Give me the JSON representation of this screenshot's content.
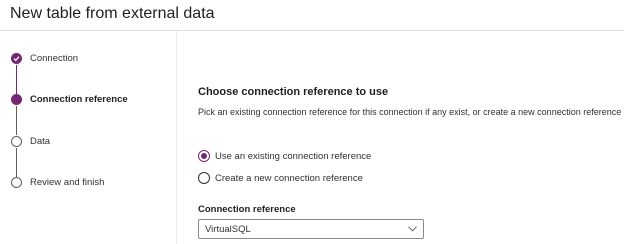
{
  "header": {
    "title": "New table from external data"
  },
  "stepper": {
    "steps": [
      {
        "label": "Connection",
        "state": "completed"
      },
      {
        "label": "Connection reference",
        "state": "current"
      },
      {
        "label": "Data",
        "state": "pending"
      },
      {
        "label": "Review and finish",
        "state": "pending"
      }
    ]
  },
  "main": {
    "title": "Choose connection reference to use",
    "description": "Pick an existing connection reference for this connection if any exist, or create a new connection reference",
    "options": [
      {
        "label": "Use an existing connection reference",
        "selected": true
      },
      {
        "label": "Create a new connection reference",
        "selected": false
      }
    ],
    "field": {
      "label": "Connection reference",
      "value": "VirtualSQL"
    }
  },
  "icons": {
    "completed_step": "checkmark-icon",
    "dropdown": "chevron-down-icon"
  },
  "colors": {
    "accent": "#742774",
    "text": "#323130",
    "border": "#8a8886"
  }
}
